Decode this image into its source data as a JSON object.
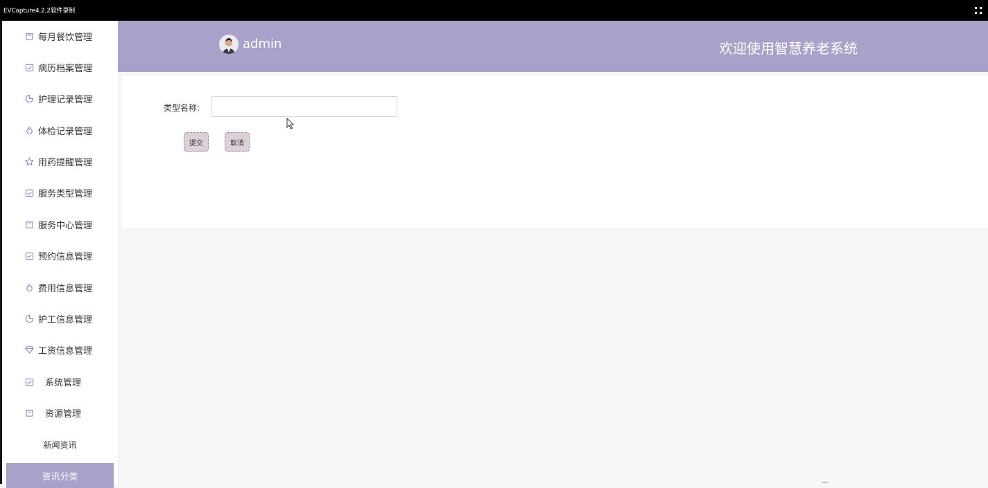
{
  "window": {
    "title": "EVCapture4.2.2软件录制"
  },
  "sidebar": {
    "items": [
      {
        "label": "每月餐饮管理",
        "icon": "bin-icon"
      },
      {
        "label": "病历档案管理",
        "icon": "calendar-check-icon"
      },
      {
        "label": "护理记录管理",
        "icon": "pie-icon"
      },
      {
        "label": "体检记录管理",
        "icon": "fire-icon"
      },
      {
        "label": "用药提醒管理",
        "icon": "star-icon"
      },
      {
        "label": "服务类型管理",
        "icon": "calendar-check-icon"
      },
      {
        "label": "服务中心管理",
        "icon": "bin-icon"
      },
      {
        "label": "预约信息管理",
        "icon": "calendar-check-icon"
      },
      {
        "label": "费用信息管理",
        "icon": "fire-icon"
      },
      {
        "label": "护工信息管理",
        "icon": "pie-icon"
      },
      {
        "label": "工资信息管理",
        "icon": "diamond-icon"
      },
      {
        "label": "系统管理",
        "icon": "calendar-check-icon"
      },
      {
        "label": "资源管理",
        "icon": "bin-icon"
      },
      {
        "label": "新闻资讯",
        "icon": ""
      },
      {
        "label": "资讯分类",
        "icon": "",
        "active": true
      }
    ]
  },
  "header": {
    "username": "admin",
    "welcome": "欢迎使用智慧养老系统",
    "color": "#a9a1ca"
  },
  "form": {
    "type_name_label": "类型名称:",
    "type_name_value": "",
    "submit_label": "提交",
    "cancel_label": "取消"
  },
  "colors": {
    "accent": "#a9a1ca",
    "button_fill": "#dcd0d8",
    "button_border": "#a587a8"
  }
}
